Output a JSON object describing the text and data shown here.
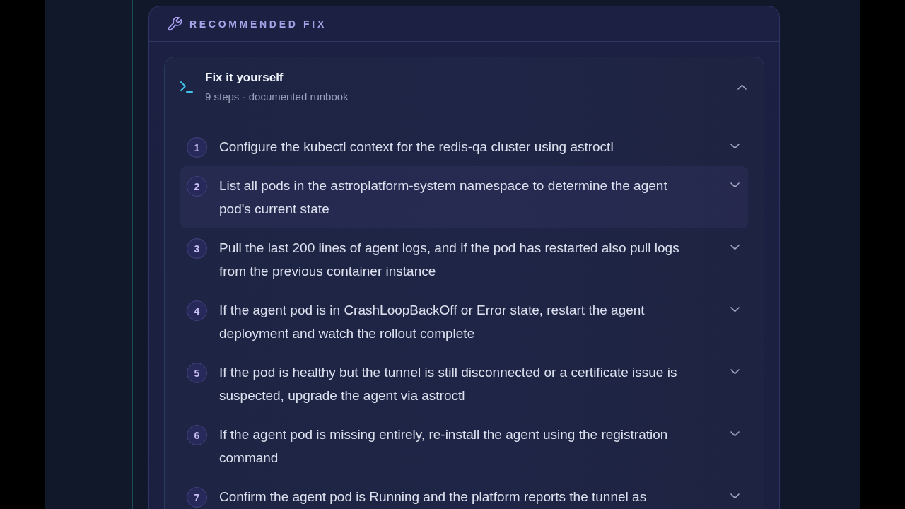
{
  "panel": {
    "title": "RECOMMENDED FIX"
  },
  "runbook": {
    "title": "Fix it yourself",
    "subtitle": "9 steps · documented runbook",
    "expanded": true,
    "steps": [
      {
        "number": "1",
        "text": "Configure the kubectl context for the redis-qa cluster using astroctl",
        "expanded": false,
        "highlighted": false
      },
      {
        "number": "2",
        "text": "List all pods in the astroplatform-system namespace to determine the agent pod's current state",
        "expanded": false,
        "highlighted": true
      },
      {
        "number": "3",
        "text": "Pull the last 200 lines of agent logs, and if the pod has restarted also pull logs from the previous container instance",
        "expanded": false,
        "highlighted": false
      },
      {
        "number": "4",
        "text": "If the agent pod is in CrashLoopBackOff or Error state, restart the agent deployment and watch the rollout complete",
        "expanded": false,
        "highlighted": false
      },
      {
        "number": "5",
        "text": "If the pod is healthy but the tunnel is still disconnected or a certificate issue is suspected, upgrade the agent via astroctl",
        "expanded": false,
        "highlighted": false
      },
      {
        "number": "6",
        "text": "If the agent pod is missing entirely, re-install the agent using the registration command",
        "expanded": false,
        "highlighted": false
      },
      {
        "number": "7",
        "text": "Confirm the agent pod is Running and the platform reports the tunnel as",
        "expanded": false,
        "highlighted": false
      }
    ]
  }
}
